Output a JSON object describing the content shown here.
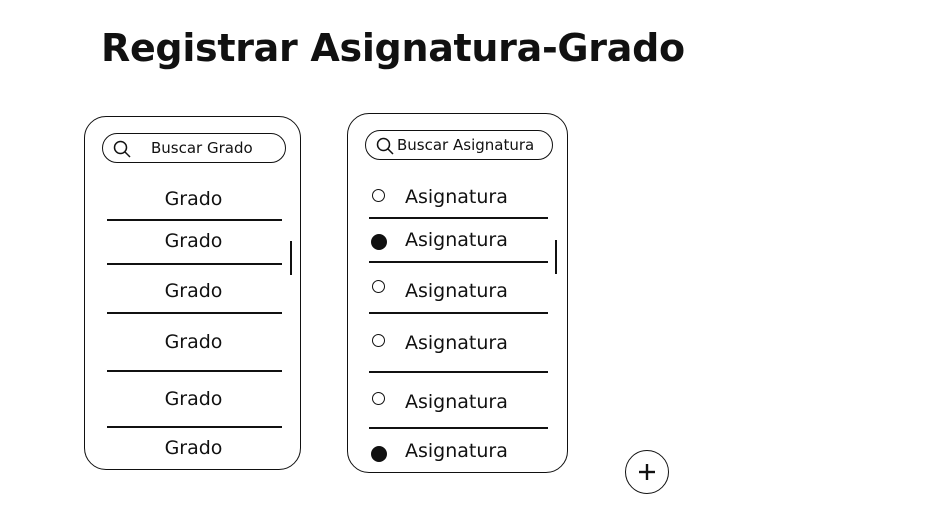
{
  "page": {
    "title": "Registrar Asignatura-Grado"
  },
  "grados": {
    "search_placeholder": "Buscar Grado",
    "items": [
      "Grado",
      "Grado",
      "Grado",
      "Grado",
      "Grado",
      "Grado"
    ]
  },
  "asignaturas": {
    "search_placeholder": "Buscar Asignatura",
    "items": [
      {
        "label": "Asignatura",
        "selected": false
      },
      {
        "label": "Asignatura",
        "selected": true
      },
      {
        "label": "Asignatura",
        "selected": false
      },
      {
        "label": "Asignatura",
        "selected": false
      },
      {
        "label": "Asignatura",
        "selected": false
      },
      {
        "label": "Asignatura",
        "selected": true
      }
    ]
  },
  "icons": {
    "search": "search-icon",
    "add": "plus-icon"
  }
}
